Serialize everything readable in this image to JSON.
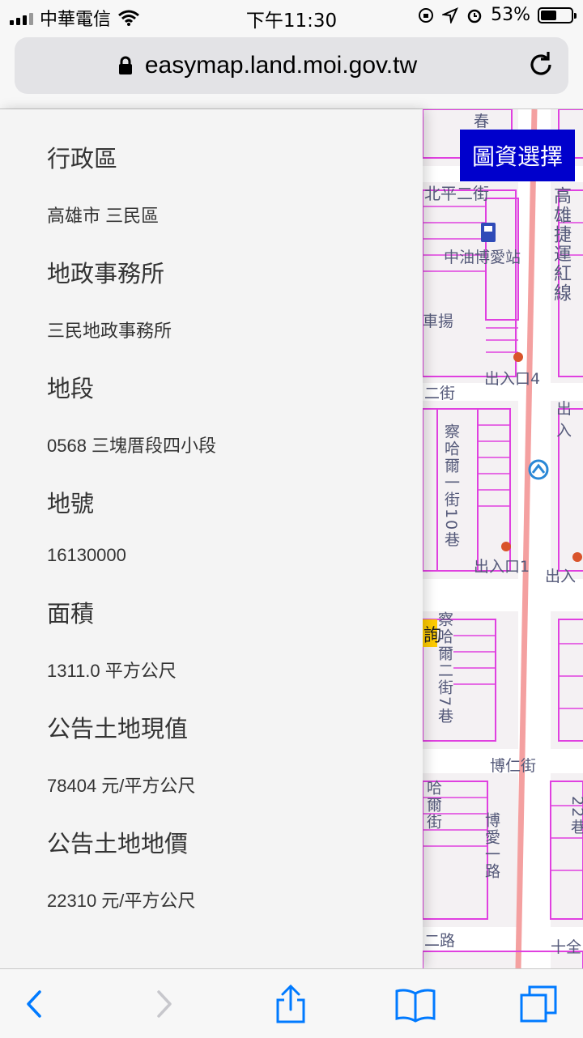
{
  "status_bar": {
    "carrier": "中華電信",
    "time": "下午11:30",
    "battery_percent": "53%",
    "battery_level": 0.53
  },
  "browser": {
    "url": "easymap.land.moi.gov.tw"
  },
  "map": {
    "layer_button_label": "圖資選擇",
    "labels": {
      "street_north": "北平二街",
      "station": "中油博愛站",
      "mrt_line": "高雄捷運紅線",
      "partial_top": "春",
      "partial_left": "車揚",
      "exit4": "出入口4",
      "exit_right": "出入",
      "lane_vertical_1": "察哈爾一街10巷",
      "exit1": "出入口1",
      "exit_right2": "出入",
      "lane_vertical_2": "察哈爾二街7巷",
      "bourn_street": "博仁街",
      "avenue": "博愛一路",
      "side_lane": "哈爾街",
      "right_lane": "22巷",
      "bottom_road": "二路",
      "bottom_right": "十全",
      "highlight": "詢",
      "partial_street": "二街"
    }
  },
  "panel": {
    "fields": [
      {
        "title": "行政區",
        "value": "高雄市 三民區"
      },
      {
        "title": "地政事務所",
        "value": "三民地政事務所"
      },
      {
        "title": "地段",
        "value": "0568 三塊厝段四小段"
      },
      {
        "title": "地號",
        "value": "16130000"
      },
      {
        "title": "面積",
        "value": "1311.0 平方公尺"
      },
      {
        "title": "公告土地現值",
        "value": "78404 元/平方公尺"
      },
      {
        "title": "公告土地地價",
        "value": "22310 元/平方公尺"
      }
    ]
  },
  "toolbar": {
    "buttons": [
      "back-icon",
      "forward-icon",
      "share-icon",
      "bookmarks-icon",
      "tabs-icon"
    ]
  },
  "colors": {
    "accent": "#007aff",
    "map_button": "#0000cc",
    "parcel_lines": "#e040e0",
    "mrt_line": "#f4a0a0"
  }
}
